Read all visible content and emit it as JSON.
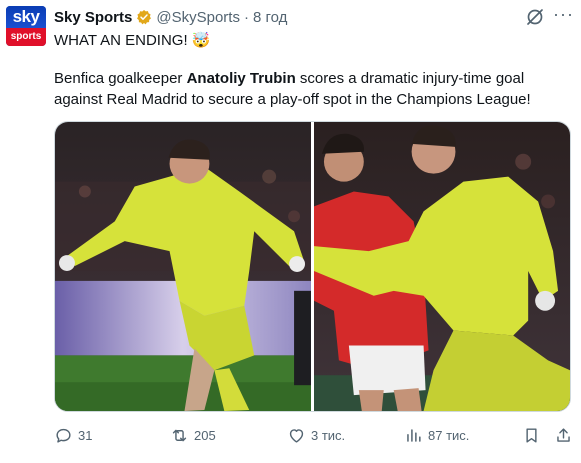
{
  "account": {
    "avatar_top": "sky",
    "avatar_bottom": "sports",
    "name": "Sky Sports",
    "handle": "@SkySports",
    "separator": "·",
    "time": "8 год"
  },
  "tweet": {
    "line1": "WHAT AN ENDING! 🤯",
    "body_pre": "Benfica goalkeeper ",
    "body_bold": "Anatoliy Trubin",
    "body_post": " scores a dramatic injury-time goal against Real Madrid to secure a play-off spot in the Champions League!"
  },
  "media": {
    "photos": [
      {
        "icon": "photo-goalkeeper-running"
      },
      {
        "icon": "photo-goalkeeper-celebrating"
      }
    ]
  },
  "actions": {
    "replies": "31",
    "reposts": "205",
    "likes": "3 тис.",
    "views": "87 тис."
  },
  "colors": {
    "verified": "#e2a81a",
    "muted": "#536471",
    "text": "#0f1419",
    "sky_blue": "#0a3db4",
    "sky_red": "#e0102a"
  }
}
